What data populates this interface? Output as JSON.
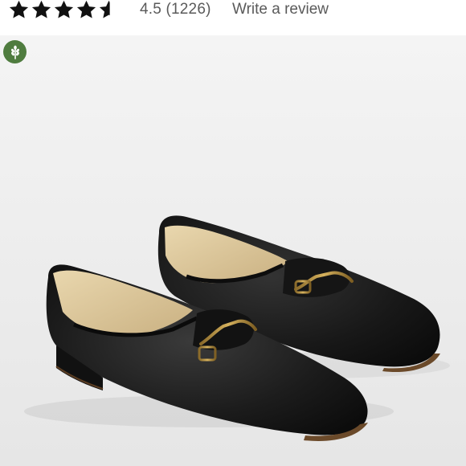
{
  "rating": {
    "value": 4.5,
    "summary_text": "4.5 (1226)",
    "write_review_label": "Write a review",
    "star_color": "#111111"
  },
  "badge": {
    "icon": "wheat-leaf-icon",
    "color": "#4f7c3f"
  },
  "image": {
    "icon": "loafer-shoes-product-photo"
  }
}
